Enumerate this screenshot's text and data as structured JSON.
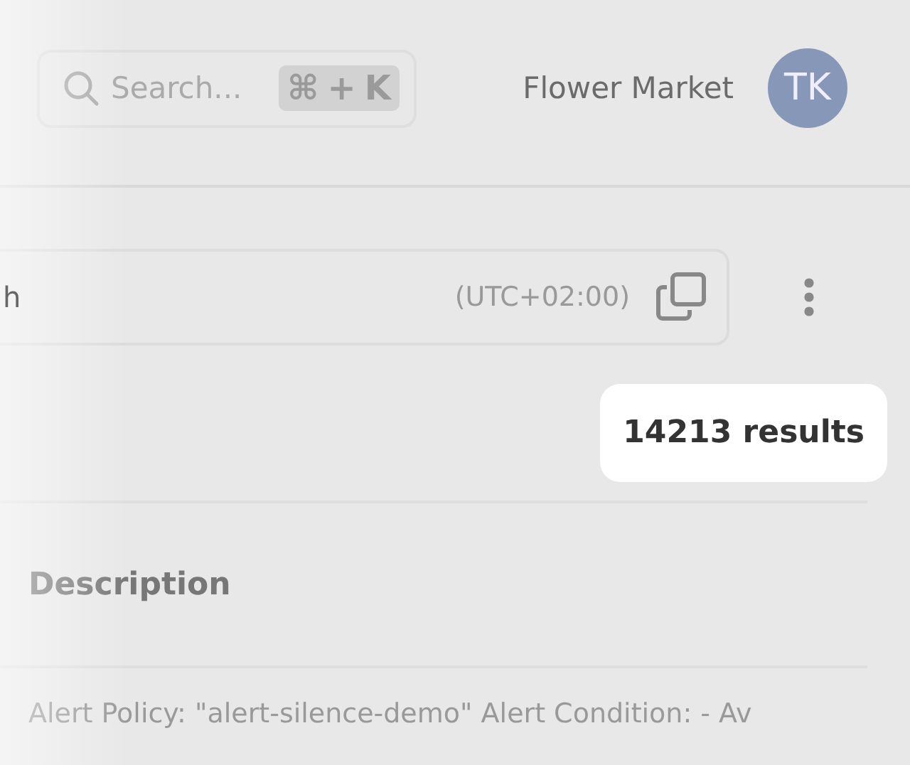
{
  "header": {
    "search": {
      "placeholder": "Search...",
      "shortcut": [
        "⌘",
        "+",
        "K"
      ]
    },
    "organization": "Flower Market",
    "avatar": "TK"
  },
  "toolbar": {
    "field_text": "h",
    "timezone": "(UTC+02:00)"
  },
  "results": {
    "count": "14213 results"
  },
  "table": {
    "columns": [
      "Description"
    ],
    "rows": [
      {
        "description": "Alert Policy: \"alert-silence-demo\" Alert Condition: - Av"
      }
    ]
  }
}
